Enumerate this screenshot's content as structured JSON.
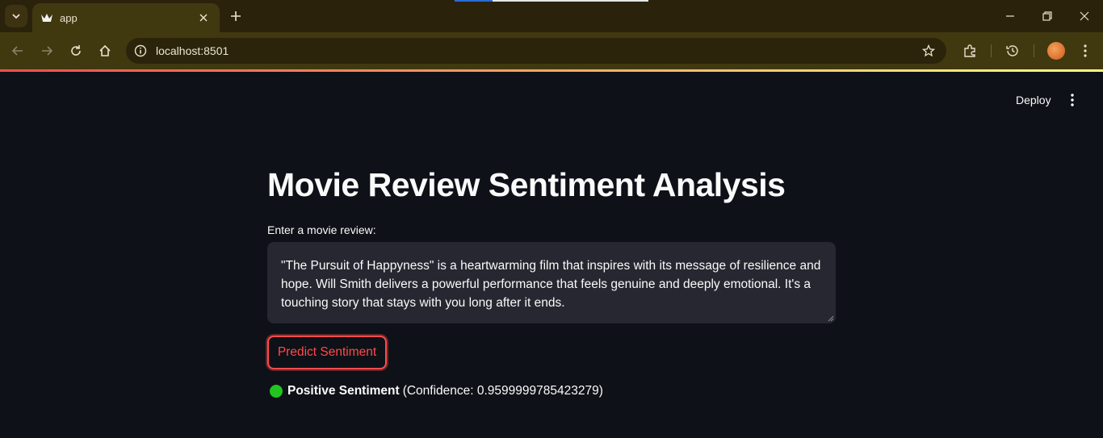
{
  "browser": {
    "tab_title": "app",
    "url": "localhost:8501"
  },
  "header": {
    "deploy_label": "Deploy"
  },
  "main": {
    "title": "Movie Review Sentiment Analysis",
    "input_label": "Enter a movie review:",
    "review_text": "\"The Pursuit of Happyness\" is a heartwarming film that inspires with its message of resilience and hope. Will Smith delivers a powerful performance that feels genuine and deeply emotional. It's a touching story that stays with you long after it ends.",
    "predict_button": "Predict Sentiment",
    "result": {
      "label": "Positive Sentiment",
      "detail": "(Confidence: 0.9599999785423279)",
      "indicator_color": "#22c51f"
    }
  },
  "colors": {
    "accent": "#ff4b4b",
    "page_bg": "#0e1117",
    "input_bg": "#262730",
    "chrome_bg": "#40380f"
  }
}
